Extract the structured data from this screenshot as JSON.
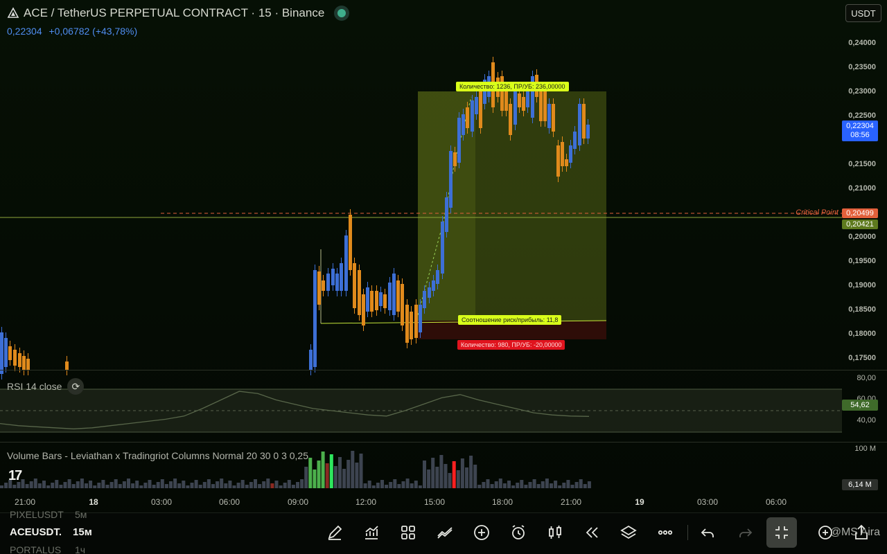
{
  "header": {
    "title": "ACE / TetherUS PERPETUAL CONTRACT · 15 · Binance",
    "price": "0,22304",
    "change": "+0,06782 (+43,78%)",
    "currency": "USDT"
  },
  "price_axis": {
    "labels": [
      "0,24000",
      "0,23500",
      "0,23000",
      "0,22500",
      "0,21500",
      "0,21000",
      "0,20000",
      "0,19500",
      "0,19000",
      "0,18500",
      "0,18000",
      "0,17500"
    ],
    "current_price": "0,22304",
    "countdown": "08:56",
    "critical_price": "0,20499",
    "line_price": "0,20421"
  },
  "critical_point_label": "Critical Point",
  "position_tool": {
    "target_label": "Количество: 1236, ПР/УБ: 236,00000",
    "ratio_label": "Соотношение риск/прибыль: 11,8",
    "stop_label": "Количество: 980, ПР/УБ: -20,00000"
  },
  "time_axis": [
    "21:00",
    "18",
    "03:00",
    "06:00",
    "09:00",
    "12:00",
    "15:00",
    "18:00",
    "21:00",
    "19",
    "03:00",
    "06:00"
  ],
  "rsi": {
    "title": "RSI 14 close",
    "labels": [
      "80,00",
      "60,00",
      "40,00"
    ],
    "value": "54,62"
  },
  "volume": {
    "title": "Volume Bars - Leviathan x Tradingriot Columns Normal 20 30 0 3 0,25",
    "top_label": "100 M",
    "value": "6,14 M"
  },
  "bottom": {
    "ghost_rows": [
      {
        "symbol": "PIXELUSDT",
        "tf": "5м"
      },
      {
        "symbol": "PORTALUS",
        "tf": "1ч"
      }
    ],
    "symbol": "ACEUSDT.",
    "timeframe": "15м",
    "watermark": "@MS Aira"
  },
  "colors": {
    "up": "#3d6fd6",
    "down": "#e08a1c",
    "accent_green": "#ccff00",
    "price_badge": "#2962ff",
    "stop_red": "#e0141e"
  },
  "chart_data": {
    "type": "candlestick",
    "series": [
      {
        "name": "ACEUSDT.P 15m",
        "ohlc": [
          [
            0.1765,
            0.1778,
            0.1748,
            0.176
          ],
          [
            0.176,
            0.179,
            0.1755,
            0.1782
          ],
          [
            0.1782,
            0.1795,
            0.177,
            0.1772
          ],
          [
            0.1772,
            0.178,
            0.1758,
            0.1762
          ],
          [
            0.1762,
            0.177,
            0.1745,
            0.1752
          ]
        ]
      },
      {
        "name": "RSI 14",
        "values": [
          48,
          46,
          45,
          44,
          43,
          44,
          46,
          48,
          50,
          52,
          55,
          62,
          70,
          78,
          76,
          70,
          66,
          62,
          60,
          58,
          56,
          55,
          60,
          66,
          72,
          75,
          70,
          66,
          62,
          58,
          56,
          55,
          54.62
        ]
      }
    ],
    "ylim": [
      0.173,
      0.2425
    ]
  }
}
